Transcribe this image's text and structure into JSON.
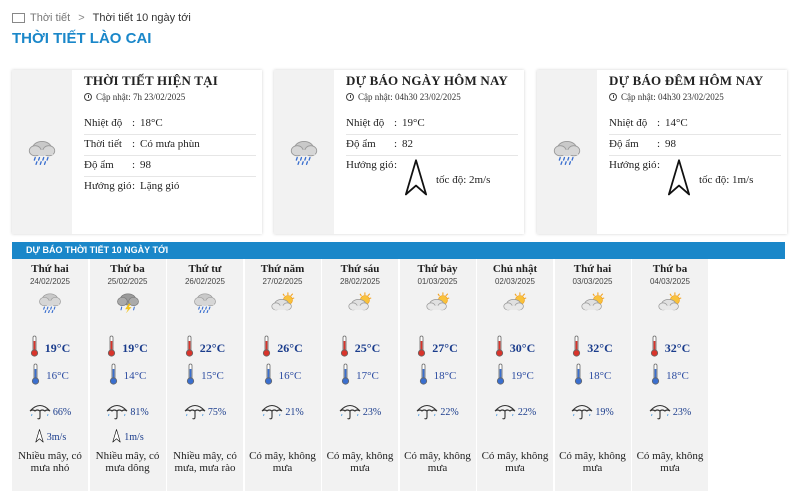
{
  "breadcrumb": {
    "home": "Thời tiết",
    "sep": ">",
    "current": "Thời tiết 10 ngày tới"
  },
  "page_title": "THỜI TIẾT LÀO CAI",
  "cards": [
    {
      "heading": "THỜI TIẾT HIỆN TẠI",
      "updated": "Cập nhật: 7h 23/02/2025",
      "icon": "rain-cloud-icon",
      "rows": [
        {
          "label": "Nhiệt độ",
          "value": "18°C"
        },
        {
          "label": "Thời tiết",
          "value": "Có mưa phùn"
        },
        {
          "label": "Độ ẩm",
          "value": "98"
        },
        {
          "label": "Hướng gió",
          "value": "Lặng gió"
        }
      ]
    },
    {
      "heading": "DỰ BÁO NGÀY HÔM NAY",
      "updated": "Cập nhật: 04h30 23/02/2025",
      "icon": "rain-cloud-icon",
      "rows": [
        {
          "label": "Nhiệt độ",
          "value": "19°C"
        },
        {
          "label": "Độ ẩm",
          "value": "82"
        },
        {
          "label": "Hướng gió",
          "value": "tốc độ: 2m/s"
        }
      ]
    },
    {
      "heading": "DỰ BÁO ĐÊM HÔM NAY",
      "updated": "Cập nhật: 04h30 23/02/2025",
      "icon": "rain-cloud-icon",
      "rows": [
        {
          "label": "Nhiệt độ",
          "value": "14°C"
        },
        {
          "label": "Độ ẩm",
          "value": "98"
        },
        {
          "label": "Hướng gió",
          "value": "tốc độ: 1m/s"
        }
      ]
    }
  ],
  "forecast_title": "DỰ BÁO THỜI TIẾT 10 NGÀY TỚI",
  "days": [
    {
      "name": "Thứ hai",
      "date": "24/02/2025",
      "icon": "rain-cloud-icon",
      "hi": "19°C",
      "lo": "16°C",
      "rain": "66%",
      "wind": "3m/s",
      "desc": "Nhiều mây, có mưa nhỏ"
    },
    {
      "name": "Thứ ba",
      "date": "25/02/2025",
      "icon": "thunder-rain-icon",
      "hi": "19°C",
      "lo": "14°C",
      "rain": "81%",
      "wind": "1m/s",
      "desc": "Nhiều mây, có mưa dông"
    },
    {
      "name": "Thứ tư",
      "date": "26/02/2025",
      "icon": "rain-cloud-icon",
      "hi": "22°C",
      "lo": "15°C",
      "rain": "75%",
      "wind": "",
      "desc": "Nhiều mây, có mưa, mưa rào"
    },
    {
      "name": "Thứ năm",
      "date": "27/02/2025",
      "icon": "sun-cloud-icon",
      "hi": "26°C",
      "lo": "16°C",
      "rain": "21%",
      "wind": "",
      "desc": "Có mây, không mưa"
    },
    {
      "name": "Thứ sáu",
      "date": "28/02/2025",
      "icon": "sun-cloud-icon",
      "hi": "25°C",
      "lo": "17°C",
      "rain": "23%",
      "wind": "",
      "desc": "Có mây, không mưa"
    },
    {
      "name": "Thứ bảy",
      "date": "01/03/2025",
      "icon": "sun-cloud-icon",
      "hi": "27°C",
      "lo": "18°C",
      "rain": "22%",
      "wind": "",
      "desc": "Có mây, không mưa"
    },
    {
      "name": "Chủ nhật",
      "date": "02/03/2025",
      "icon": "sun-cloud-icon",
      "hi": "30°C",
      "lo": "19°C",
      "rain": "22%",
      "wind": "",
      "desc": "Có mây, không mưa"
    },
    {
      "name": "Thứ hai",
      "date": "03/03/2025",
      "icon": "sun-cloud-icon",
      "hi": "32°C",
      "lo": "18°C",
      "rain": "19%",
      "wind": "",
      "desc": "Có mây, không mưa"
    },
    {
      "name": "Thứ ba",
      "date": "04/03/2025",
      "icon": "sun-cloud-icon",
      "hi": "32°C",
      "lo": "18°C",
      "rain": "23%",
      "wind": "",
      "desc": "Có mây, không mưa"
    }
  ],
  "colors": {
    "accent": "#1a87c9",
    "temp_text": "#1a3c8c"
  }
}
